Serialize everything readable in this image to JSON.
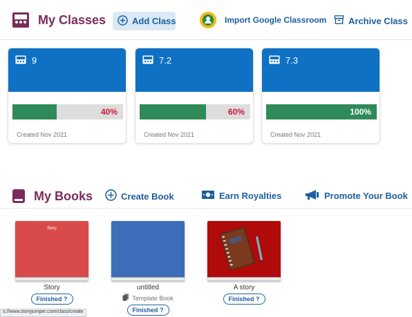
{
  "header": {
    "title": "My Classes",
    "add_class": "Add Class",
    "import_google": "Import Google Classroom",
    "archive_class": "Archive Class"
  },
  "classes": [
    {
      "name": "9",
      "progress_label": "40%",
      "progress": 0.4,
      "created": "Created Nov 2021"
    },
    {
      "name": "7.2",
      "progress_label": "60%",
      "progress": 0.6,
      "created": "Created Nov 2021"
    },
    {
      "name": "7.3",
      "progress_label": "100%",
      "progress": 1.0,
      "created": "Created Nov 2021"
    }
  ],
  "books_section": {
    "title": "My Books",
    "create_book": "Create Book",
    "earn_royalties": "Earn Royalties",
    "promote_book": "Promote Your Book"
  },
  "books": [
    {
      "title": "Story",
      "cover_text": "Story",
      "status": "Finished ?",
      "cover_color": "#d94a4a"
    },
    {
      "title": "untitled",
      "template_label": "Template Book",
      "status": "Finished ?",
      "cover_color": "#3e6eb9"
    },
    {
      "title": "A story",
      "status": "Finished ?",
      "cover_color": "#b00a0a"
    }
  ],
  "status_bar": {
    "url": "s://www.storyjumper.com/class/create"
  },
  "colors": {
    "brand_purple": "#7b2c5b",
    "link_blue": "#1d5fa1",
    "class_blue": "#0f71c4",
    "progress_green": "#2e8b57",
    "progress_red_text": "#d2123d"
  }
}
